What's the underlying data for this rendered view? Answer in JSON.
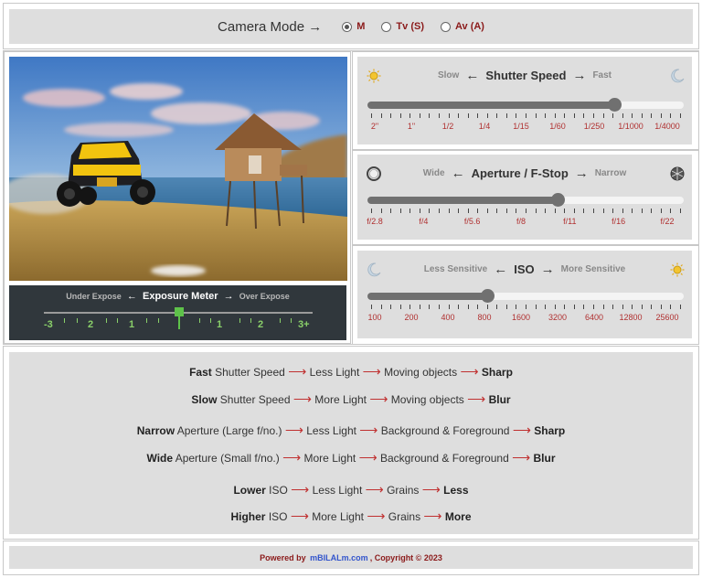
{
  "camera_mode": {
    "title": "Camera Mode",
    "arrow": "→",
    "options": [
      {
        "label": "M",
        "selected": true
      },
      {
        "label": "Tv (S)",
        "selected": false
      },
      {
        "label": "Av (A)",
        "selected": false
      }
    ]
  },
  "exposure_meter": {
    "left": "Under Expose",
    "title": "Exposure Meter",
    "right": "Over Expose",
    "arrow_left": "←",
    "arrow_right": "→",
    "scale": [
      "-3",
      "2",
      "1",
      "1",
      "2",
      "3+"
    ],
    "level": 0
  },
  "shutter": {
    "left": "Slow",
    "title": "Shutter Speed",
    "right": "Fast",
    "arrow_left": "←",
    "arrow_right": "→",
    "left_icon": "sun-icon",
    "right_icon": "moon-icon",
    "labels": [
      "2\"",
      "1\"",
      "1/2",
      "1/4",
      "1/15",
      "1/60",
      "1/250",
      "1/1000",
      "1/4000"
    ],
    "value_fraction": 0.78
  },
  "aperture": {
    "left": "Wide",
    "title": "Aperture / F-Stop",
    "right": "Narrow",
    "arrow_left": "←",
    "arrow_right": "→",
    "left_icon": "aperture-open-icon",
    "right_icon": "aperture-closed-icon",
    "labels": [
      "f/2.8",
      "f/4",
      "f/5.6",
      "f/8",
      "f/11",
      "f/16",
      "f/22"
    ],
    "value_fraction": 0.6
  },
  "iso": {
    "left": "Less Sensitive",
    "title": "ISO",
    "right": "More Sensitive",
    "arrow_left": "←",
    "arrow_right": "→",
    "left_icon": "moon-icon",
    "right_icon": "sun-icon",
    "labels": [
      "100",
      "200",
      "400",
      "800",
      "1600",
      "3200",
      "6400",
      "12800",
      "25600"
    ],
    "value_fraction": 0.38
  },
  "info": [
    {
      "bold": "Fast",
      "text": "Shutter Speed",
      "a": "Less Light",
      "b": "Moving objects",
      "c": "Sharp"
    },
    {
      "bold": "Slow",
      "text": "Shutter Speed",
      "a": "More Light",
      "b": "Moving objects",
      "c": "Blur"
    },
    {
      "bold": "Narrow",
      "text": "Aperture (Large f/no.)",
      "a": "Less Light",
      "b": "Background & Foreground",
      "c": "Sharp"
    },
    {
      "bold": "Wide",
      "text": "Aperture (Small f/no.)",
      "a": "More Light",
      "b": "Background & Foreground",
      "c": "Blur"
    },
    {
      "bold": "Lower",
      "text": "ISO",
      "a": "Less Light",
      "b": "Grains",
      "c": "Less"
    },
    {
      "bold": "Higher",
      "text": "ISO",
      "a": "More Light",
      "b": "Grains",
      "c": "More"
    }
  ],
  "info_arrow": "⟶",
  "footer": {
    "prefix": "Powered by",
    "link": "mBILALm.com",
    "suffix": ", Copyright © 2023"
  },
  "colors": {
    "panel": "#dedede",
    "accent_red": "#b03030",
    "meter_green": "#5ec24a",
    "meter_bg": "#30373c"
  }
}
